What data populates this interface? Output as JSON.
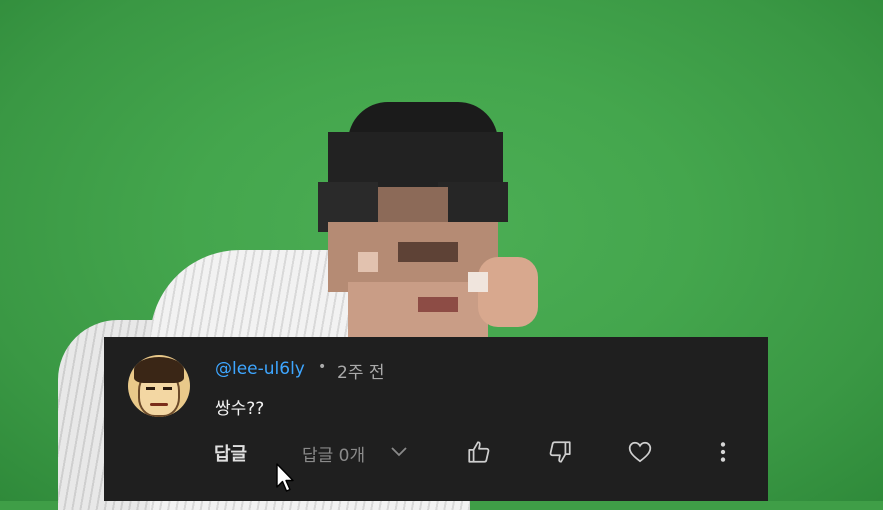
{
  "comment": {
    "author": "@lee-ul6ly",
    "separator": "•",
    "time": "2주 전",
    "text": "쌍수??",
    "reply_label": "답글",
    "replies_label": "답글 0개"
  },
  "icons": {
    "expand": "chevron-down-icon",
    "like": "thumb-up-icon",
    "dislike": "thumb-down-icon",
    "heart": "heart-icon",
    "more": "more-vert-icon"
  },
  "colors": {
    "panel_bg": "#1f1f1f",
    "author": "#3ea6ff",
    "meta": "#aaaaaa",
    "text": "#f1f1f1",
    "background": "#3f9e47"
  }
}
